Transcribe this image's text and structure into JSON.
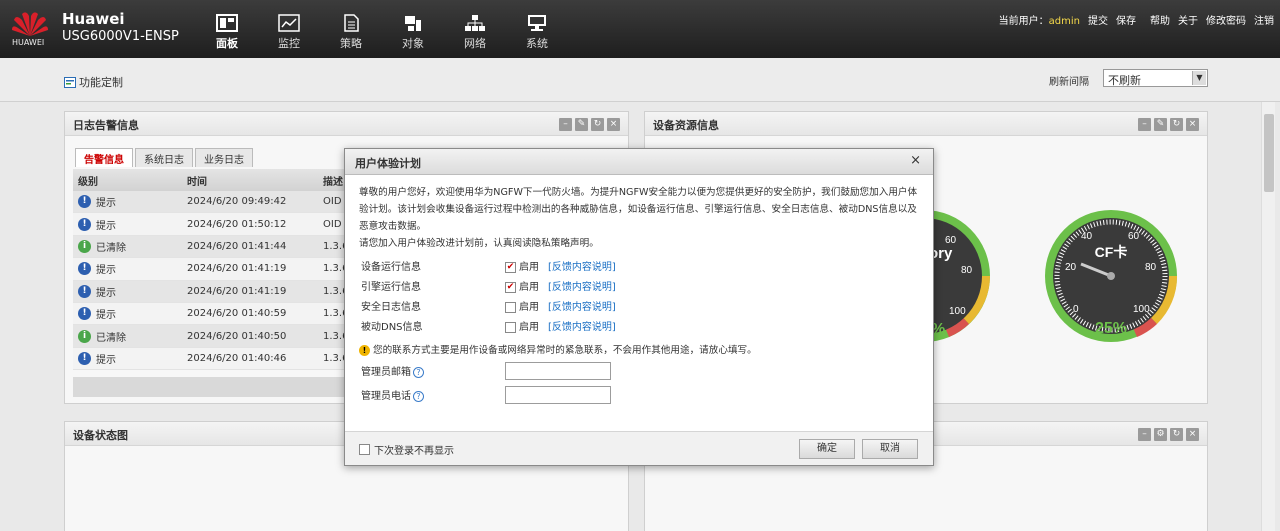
{
  "header": {
    "logo_text": "HUAWEI",
    "brand_name": "Huawei",
    "device": "USG6000V1-ENSP",
    "nav": [
      {
        "label": "面板",
        "icon": "dashboard-icon"
      },
      {
        "label": "监控",
        "icon": "monitor-chart-icon"
      },
      {
        "label": "策略",
        "icon": "policy-doc-icon"
      },
      {
        "label": "对象",
        "icon": "object-icon"
      },
      {
        "label": "网络",
        "icon": "network-icon"
      },
      {
        "label": "系统",
        "icon": "system-icon"
      }
    ],
    "user_label": "当前用户：",
    "user_name": "admin",
    "links": [
      "提交",
      "保存",
      "帮助",
      "关于",
      "修改密码",
      "注销"
    ]
  },
  "toolbar": {
    "customize_label": "功能定制",
    "refresh_label": "刷新间隔",
    "refresh_value": "不刷新"
  },
  "log_panel": {
    "title": "日志告警信息",
    "tabs": [
      "告警信息",
      "系统日志",
      "业务日志"
    ],
    "columns": [
      "级别",
      "时间",
      "描述"
    ],
    "rows": [
      {
        "level": "提示",
        "type": "info",
        "time": "2024/6/20 09:49:42",
        "desc": "OID"
      },
      {
        "level": "提示",
        "type": "info",
        "time": "2024/6/20 01:50:12",
        "desc": "OID"
      },
      {
        "level": "已清除",
        "type": "cleared",
        "time": "2024/6/20 01:41:44",
        "desc": "1.3.6"
      },
      {
        "level": "提示",
        "type": "info",
        "time": "2024/6/20 01:41:19",
        "desc": "1.3.6"
      },
      {
        "level": "提示",
        "type": "info",
        "time": "2024/6/20 01:41:19",
        "desc": "1.3.6"
      },
      {
        "level": "提示",
        "type": "info",
        "time": "2024/6/20 01:40:59",
        "desc": "1.3.6"
      },
      {
        "level": "已清除",
        "type": "cleared",
        "time": "2024/6/20 01:40:50",
        "desc": "1.3.6"
      },
      {
        "level": "提示",
        "type": "info",
        "time": "2024/6/20 01:40:46",
        "desc": "1.3.6"
      }
    ]
  },
  "resource_panel": {
    "title": "设备资源信息",
    "gauges": [
      {
        "label": "ory",
        "value_text": "%",
        "percent": 0.25
      },
      {
        "label": "CF卡",
        "value_text": "25%",
        "percent": 0.25
      }
    ],
    "ticks": [
      "20",
      "40",
      "60",
      "80",
      "100",
      "0"
    ]
  },
  "status_panel": {
    "title": "设备状态图"
  },
  "modal": {
    "title": "用户体验计划",
    "close": "×",
    "intro": "尊敬的用户您好，欢迎使用华为NGFW下一代防火墙。为提升NGFW安全能力以便为您提供更好的安全防护，我们鼓励您加入用户体验计划。该计划会收集设备运行过程中检测出的各种威胁信息，如设备运行信息、引擎运行信息、安全日志信息、被动DNS信息以及恶意攻击数据。",
    "intro2": "请您加入用户体验改进计划前，认真阅读隐私策略声明。",
    "options": [
      {
        "label": "设备运行信息",
        "checked": true,
        "enable": "启用",
        "link": "[反馈内容说明]"
      },
      {
        "label": "引擎运行信息",
        "checked": true,
        "enable": "启用",
        "link": "[反馈内容说明]"
      },
      {
        "label": "安全日志信息",
        "checked": false,
        "enable": "启用",
        "link": "[反馈内容说明]"
      },
      {
        "label": "被动DNS信息",
        "checked": false,
        "enable": "启用",
        "link": "[反馈内容说明]"
      }
    ],
    "note": "您的联系方式主要是用作设备或网络异常时的紧急联系，不会用作其他用途，请放心填写。",
    "email_label": "管理员邮箱",
    "phone_label": "管理员电话",
    "no_show": "下次登录不再显示",
    "ok": "确定",
    "cancel": "取消"
  }
}
